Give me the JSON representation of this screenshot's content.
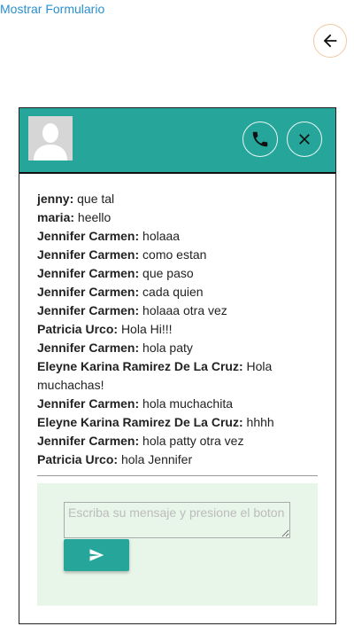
{
  "top_link": {
    "label": "Mostrar Formulario"
  },
  "icons": {
    "back": "arrow-left-icon",
    "avatar": "user-silhouette-icon",
    "call": "phone-icon",
    "close": "close-icon",
    "send": "send-icon"
  },
  "colors": {
    "header": "#26a69a",
    "composer_bg": "#e8f5e9",
    "send_button": "#26a69a",
    "link": "#2a8fd0"
  },
  "messages": [
    {
      "sender": "jenny:",
      "text": "que tal"
    },
    {
      "sender": "maria:",
      "text": "heello"
    },
    {
      "sender": "Jennifer Carmen:",
      "text": "holaaa"
    },
    {
      "sender": "Jennifer Carmen:",
      "text": "como estan"
    },
    {
      "sender": "Jennifer Carmen:",
      "text": "que paso"
    },
    {
      "sender": "Jennifer Carmen:",
      "text": "cada quien"
    },
    {
      "sender": "Jennifer Carmen:",
      "text": "holaaa otra vez"
    },
    {
      "sender": "Patricia Urco:",
      "text": "Hola Hi!!!"
    },
    {
      "sender": "Jennifer Carmen:",
      "text": "hola paty"
    },
    {
      "sender": "Eleyne Karina Ramirez De La Cruz:",
      "text": "Hola muchachas!"
    },
    {
      "sender": "Jennifer Carmen:",
      "text": "hola muchachita"
    },
    {
      "sender": "Eleyne Karina Ramirez De La Cruz:",
      "text": "hhhh"
    },
    {
      "sender": "Jennifer Carmen:",
      "text": "hola patty otra vez"
    },
    {
      "sender": "Patricia Urco:",
      "text": "hola Jennifer"
    }
  ],
  "composer": {
    "value": "",
    "placeholder": "Escriba su mensaje y presione el boton"
  }
}
